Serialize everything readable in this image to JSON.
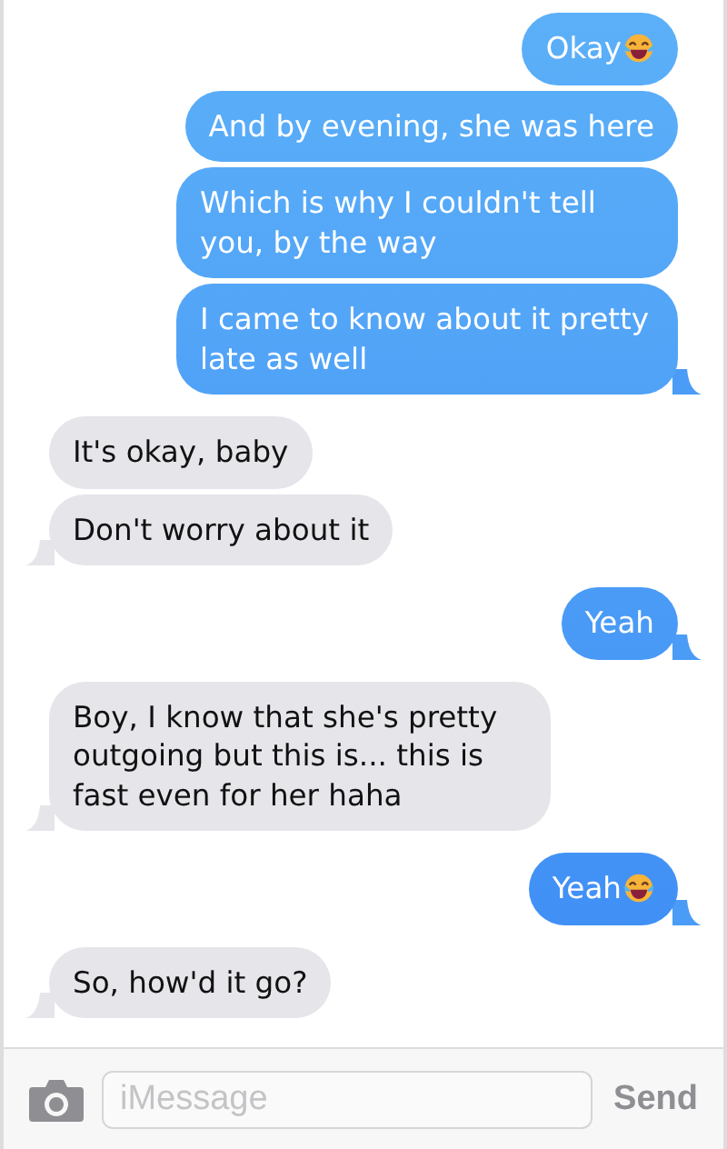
{
  "messages": [
    {
      "kind": "sent",
      "text": "Okay",
      "laugh_emoji": true,
      "tail": false
    },
    {
      "kind": "sent",
      "text": "And by evening, she was here",
      "laugh_emoji": false,
      "tail": false
    },
    {
      "kind": "sent",
      "text": "Which is why I couldn't tell you, by the way",
      "laugh_emoji": false,
      "tail": false
    },
    {
      "kind": "sent",
      "text": "I came to know about it pretty late as well",
      "laugh_emoji": false,
      "tail": true
    },
    {
      "kind": "received",
      "text": "It's okay, baby",
      "laugh_emoji": false,
      "tail": false
    },
    {
      "kind": "received",
      "text": "Don't worry about it",
      "laugh_emoji": false,
      "tail": true
    },
    {
      "kind": "sent",
      "text": "Yeah",
      "laugh_emoji": false,
      "tail": true
    },
    {
      "kind": "received",
      "text": "Boy, I know that she's pretty outgoing but this is... this is fast even for her haha",
      "laugh_emoji": false,
      "tail": true
    },
    {
      "kind": "sent",
      "text": "Yeah",
      "laugh_emoji": true,
      "tail": true
    },
    {
      "kind": "received",
      "text": "So, how'd it go?",
      "laugh_emoji": false,
      "tail": true
    }
  ],
  "composer": {
    "placeholder": "iMessage",
    "send_label": "Send"
  }
}
